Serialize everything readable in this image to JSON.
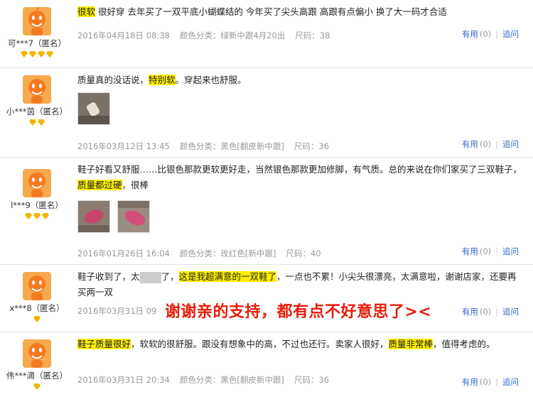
{
  "reviews": [
    {
      "user": "可***7（匿名）",
      "text_parts": [
        {
          "t": "很软",
          "hl": true
        },
        {
          "t": " 很好穿 去年买了一双平底小蝴蝶结的 今年买了尖头高跟 高跟有点偏小 换了大一码才合适",
          "hl": false
        }
      ],
      "date": "2016年04月18日 08:38",
      "color_label": "颜色分类：",
      "color": "绿新中跟4月20出",
      "size_label": "尺码：",
      "size": "38",
      "useful": "有用",
      "useful_count": "(0)",
      "ask": "追问",
      "badges": 4
    },
    {
      "user": "小***茵（匿名）",
      "text_parts": [
        {
          "t": "质量真的没话说，",
          "hl": false
        },
        {
          "t": "特别软",
          "hl": true
        },
        {
          "t": "。穿起来也舒服。",
          "hl": false
        }
      ],
      "date": "2016年03月12日 13:45",
      "color_label": "颜色分类：",
      "color": "黑色[翻皮新中跟]",
      "size_label": "尺码：",
      "size": "36",
      "useful": "有用",
      "useful_count": "(0)",
      "ask": "追问",
      "badges": 2
    },
    {
      "user": "l***9（匿名）",
      "text_parts": [
        {
          "t": "鞋子好看又舒服……比银色那款更软更好走，当然银色那款更加修脚，有气质。总的来说在你们家买了三双鞋子，",
          "hl": false
        },
        {
          "t": "质量都过硬",
          "hl": true
        },
        {
          "t": "，很棒",
          "hl": false
        }
      ],
      "date": "2016年01月26日 16:04",
      "color_label": "颜色分类：",
      "color": "玫红色[新中跟]",
      "size_label": "尺码：",
      "size": "40",
      "useful": "有用",
      "useful_count": "(0)",
      "ask": "追问",
      "badges": 3
    },
    {
      "user": "x***8（匿名）",
      "text_parts": [
        {
          "t": "鞋子收到了，太",
          "hl": false
        },
        {
          "t": "了，",
          "hl": false
        },
        {
          "t": "这是我超满意的一双鞋了",
          "hl": true
        },
        {
          "t": "，一点也不累！小尖头很漂亮，太满意啦，谢谢店家，还要再买两一双",
          "hl": false
        }
      ],
      "date": "2016年03月31日 09",
      "color_label": "颜色分类：",
      "color": "",
      "size_label": "尺码：",
      "size": "",
      "useful": "有用",
      "useful_count": "(0)",
      "ask": "追问",
      "badges": 1
    },
    {
      "user": "伟***滴（匿名）",
      "text_parts": [
        {
          "t": "鞋子质量很好",
          "hl": true
        },
        {
          "t": "，软软的很舒服。跟没有想象中的高，不过也还行。卖家人很好，",
          "hl": false
        },
        {
          "t": "质量非常棒",
          "hl": true
        },
        {
          "t": "，值得考虑的。",
          "hl": false
        }
      ],
      "date": "2016年03月31日 20:34",
      "color_label": "颜色分类：",
      "color": "黑色[翻皮新中跟]",
      "size_label": "尺码：",
      "size": "36",
      "useful": "有用",
      "useful_count": "(0)",
      "ask": "追问",
      "badges": 1
    }
  ],
  "overlay_text": "谢谢亲的支持，都有点不好意思了><",
  "icons": {
    "avatar": "orange-mascot-avatar",
    "badge": "gold-diamond-badge"
  },
  "colors": {
    "highlight": "#ffee00",
    "link": "#3366cc",
    "overlay": "#e81c0c",
    "avatar": "#f47a20"
  }
}
